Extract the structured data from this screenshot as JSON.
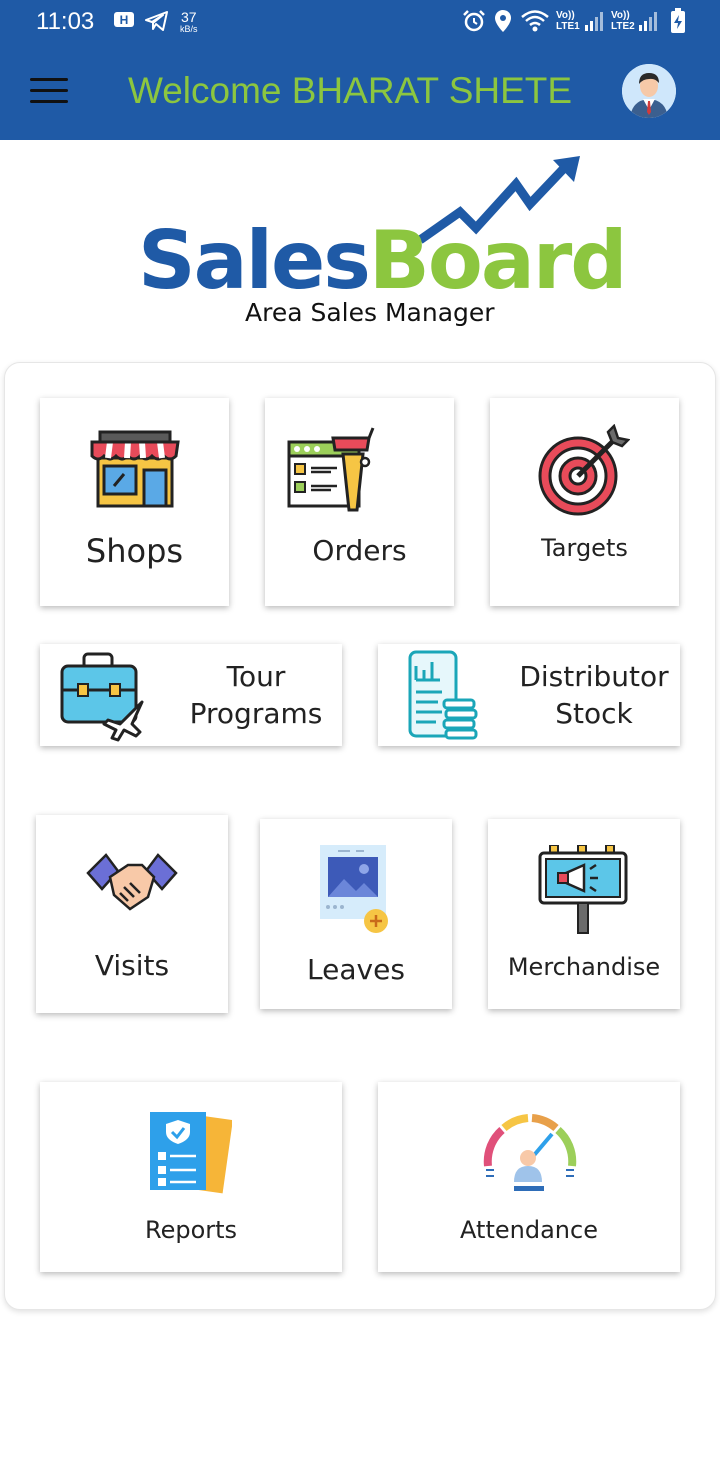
{
  "status_bar": {
    "time": "11:03",
    "net_speed_value": "37",
    "net_speed_unit": "kB/s",
    "sim1_top": "Vo))",
    "sim1_bottom": "LTE1",
    "sim2_top": "Vo))",
    "sim2_bottom": "LTE2",
    "icons": [
      "h-box-icon",
      "telegram-icon",
      "alarm-icon",
      "location-icon",
      "wifi-icon",
      "signal-icon",
      "signal-icon",
      "battery-charging-icon"
    ]
  },
  "header": {
    "welcome_text": "Welcome BHARAT SHETE",
    "menu_icon": "hamburger-menu-icon",
    "avatar_icon": "user-avatar-icon"
  },
  "logo": {
    "brand_part1": "Sales",
    "brand_part2": "Board",
    "subtitle": "Area Sales Manager"
  },
  "colors": {
    "primary": "#1f5aa6",
    "accent_green": "#8cc63f"
  },
  "tiles": {
    "shops": {
      "label": "Shops",
      "icon": "shop-icon"
    },
    "orders": {
      "label": "Orders",
      "icon": "order-list-cart-icon"
    },
    "targets": {
      "label": "Targets",
      "icon": "target-icon"
    },
    "tour_programs": {
      "label_line1": "Tour",
      "label_line2": "Programs",
      "icon": "suitcase-plane-icon"
    },
    "distributor_stock": {
      "label_line1": "Distributor",
      "label_line2": "Stock",
      "icon": "phone-stock-icon"
    },
    "visits": {
      "label": "Visits",
      "icon": "handshake-icon"
    },
    "leaves": {
      "label": "Leaves",
      "icon": "add-image-icon"
    },
    "merchandise": {
      "label": "Merchandise",
      "icon": "billboard-icon"
    },
    "reports": {
      "label": "Reports",
      "icon": "reports-icon"
    },
    "attendance": {
      "label": "Attendance",
      "icon": "gauge-person-icon"
    }
  }
}
